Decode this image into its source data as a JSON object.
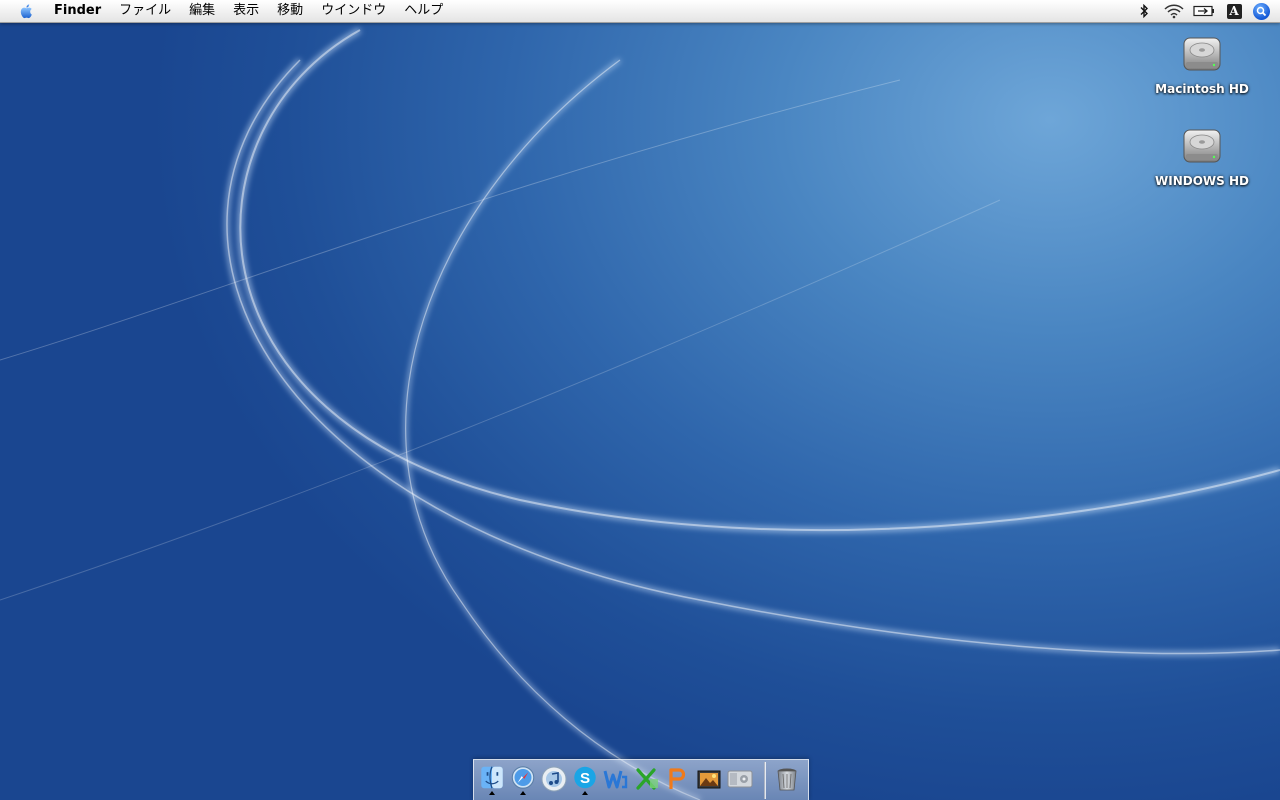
{
  "menubar": {
    "apple_icon": "apple-icon",
    "app_name": "Finder",
    "items": [
      "ファイル",
      "編集",
      "表示",
      "移動",
      "ウインドウ",
      "ヘルプ"
    ],
    "status_icons": [
      "bluetooth-icon",
      "wifi-icon",
      "battery-icon",
      "input-menu-icon",
      "spotlight-icon"
    ],
    "input_menu_glyph": "A"
  },
  "desktop": {
    "icons": [
      {
        "label": "Macintosh HD",
        "icon": "hard-drive-icon"
      },
      {
        "label": "WINDOWS HD",
        "icon": "hard-drive-icon"
      }
    ]
  },
  "dock": {
    "apps": [
      {
        "icon": "finder-icon",
        "running": true
      },
      {
        "icon": "safari-icon",
        "running": true
      },
      {
        "icon": "itunes-icon",
        "running": false
      },
      {
        "icon": "skype-icon",
        "running": true
      },
      {
        "icon": "word-icon",
        "running": false
      },
      {
        "icon": "excel-icon",
        "running": false
      },
      {
        "icon": "powerpoint-icon",
        "running": false
      },
      {
        "icon": "iphoto-icon",
        "running": false
      },
      {
        "icon": "system-preferences-icon",
        "running": false
      }
    ],
    "trash_icon": "trash-icon"
  },
  "colors": {
    "desktop_light": "#6ea6d8",
    "desktop_dark": "#1a4690",
    "menubar": "#f3f3f3"
  }
}
